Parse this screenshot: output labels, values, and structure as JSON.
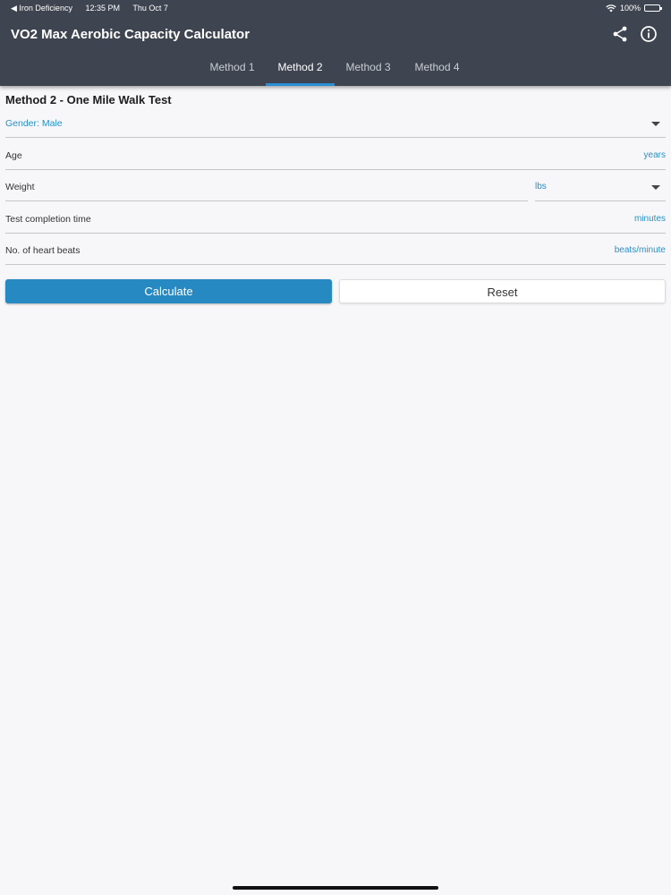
{
  "status_bar": {
    "back_app": "◀ Iron Deficiency",
    "time": "12:35 PM",
    "date": "Thu Oct 7",
    "battery": "100%"
  },
  "header": {
    "title": "VO2 Max Aerobic Capacity Calculator",
    "share_icon": "share-icon",
    "info_icon": "info-icon"
  },
  "tabs": [
    {
      "label": "Method 1",
      "active": false
    },
    {
      "label": "Method 2",
      "active": true
    },
    {
      "label": "Method 3",
      "active": false
    },
    {
      "label": "Method 4",
      "active": false
    }
  ],
  "form": {
    "section_title": "Method 2 - One Mile Walk Test",
    "gender": {
      "label": "Gender: Male"
    },
    "age": {
      "label": "Age",
      "unit": "years"
    },
    "weight": {
      "label": "Weight",
      "unit": "lbs"
    },
    "test_time": {
      "label": "Test completion time",
      "unit": "minutes"
    },
    "heart_beats": {
      "label": "No. of heart beats",
      "unit": "beats/minute"
    }
  },
  "buttons": {
    "calculate": "Calculate",
    "reset": "Reset"
  },
  "colors": {
    "header_bg": "#3f4550",
    "accent": "#2789c2",
    "tab_indicator": "#2b8fd6"
  }
}
